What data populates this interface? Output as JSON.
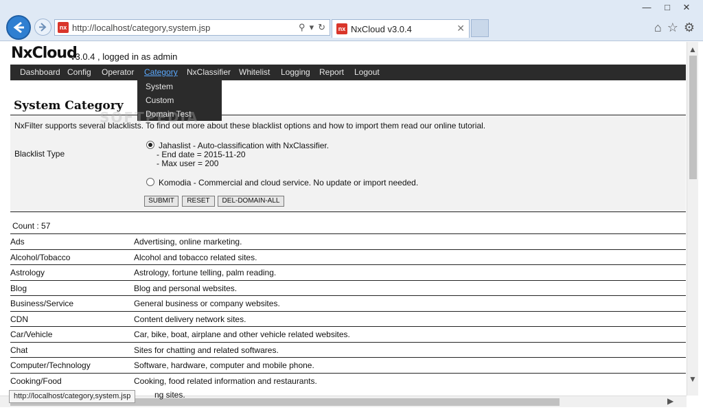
{
  "browser": {
    "address": "http://localhost/category,system.jsp",
    "tab_title": "NxCloud v3.0.4",
    "favicon_text": "nx",
    "win_min": "—",
    "win_max": "□",
    "win_close": "✕"
  },
  "header": {
    "brand": "NxCloud",
    "version_text": "v3.0.4 , logged in as admin"
  },
  "menu": {
    "items": [
      "Dashboard",
      "Config",
      "Operator",
      "Category",
      "NxClassifier",
      "Whitelist",
      "Logging",
      "Report",
      "Logout"
    ],
    "active": "Category",
    "dropdown": [
      "System",
      "Custom",
      "Domain Test"
    ]
  },
  "watermark": "SOFTPEDIA",
  "section": {
    "title": "System Category",
    "intro": "NxFilter supports several blacklists. To find out more about these blacklist options and how to import them read our online tutorial.",
    "blacklist_label": "Blacklist Type",
    "option1_line1": "Jahaslist - Auto-classification with NxClassifier.",
    "option1_line2": "- End date = 2015-11-20",
    "option1_line3": "- Max user = 200",
    "option2": "Komodia - Commercial and cloud service. No update or import needed.",
    "submit": "SUBMIT",
    "reset": "RESET",
    "del_domain_all": "DEL-DOMAIN-ALL",
    "count": "Count : 57"
  },
  "categories": [
    {
      "name": "Ads",
      "desc": "Advertising, online marketing."
    },
    {
      "name": "Alcohol/Tobacco",
      "desc": "Alcohol and tobacco related sites."
    },
    {
      "name": "Astrology",
      "desc": "Astrology, fortune telling, palm reading."
    },
    {
      "name": "Blog",
      "desc": "Blog and personal websites."
    },
    {
      "name": "Business/Service",
      "desc": "General business or company websites."
    },
    {
      "name": "CDN",
      "desc": "Content delivery network sites."
    },
    {
      "name": "Car/Vehicle",
      "desc": "Car, bike, boat, airplane and other vehicle related websites."
    },
    {
      "name": "Chat",
      "desc": "Sites for chatting and related softwares."
    },
    {
      "name": "Computer/Technology",
      "desc": "Software, hardware, computer and mobile phone."
    },
    {
      "name": "Cooking/Food",
      "desc": "Cooking, food related information and restaurants."
    }
  ],
  "status_tip": "http://localhost/category,system.jsp",
  "status_under": "ng sites."
}
